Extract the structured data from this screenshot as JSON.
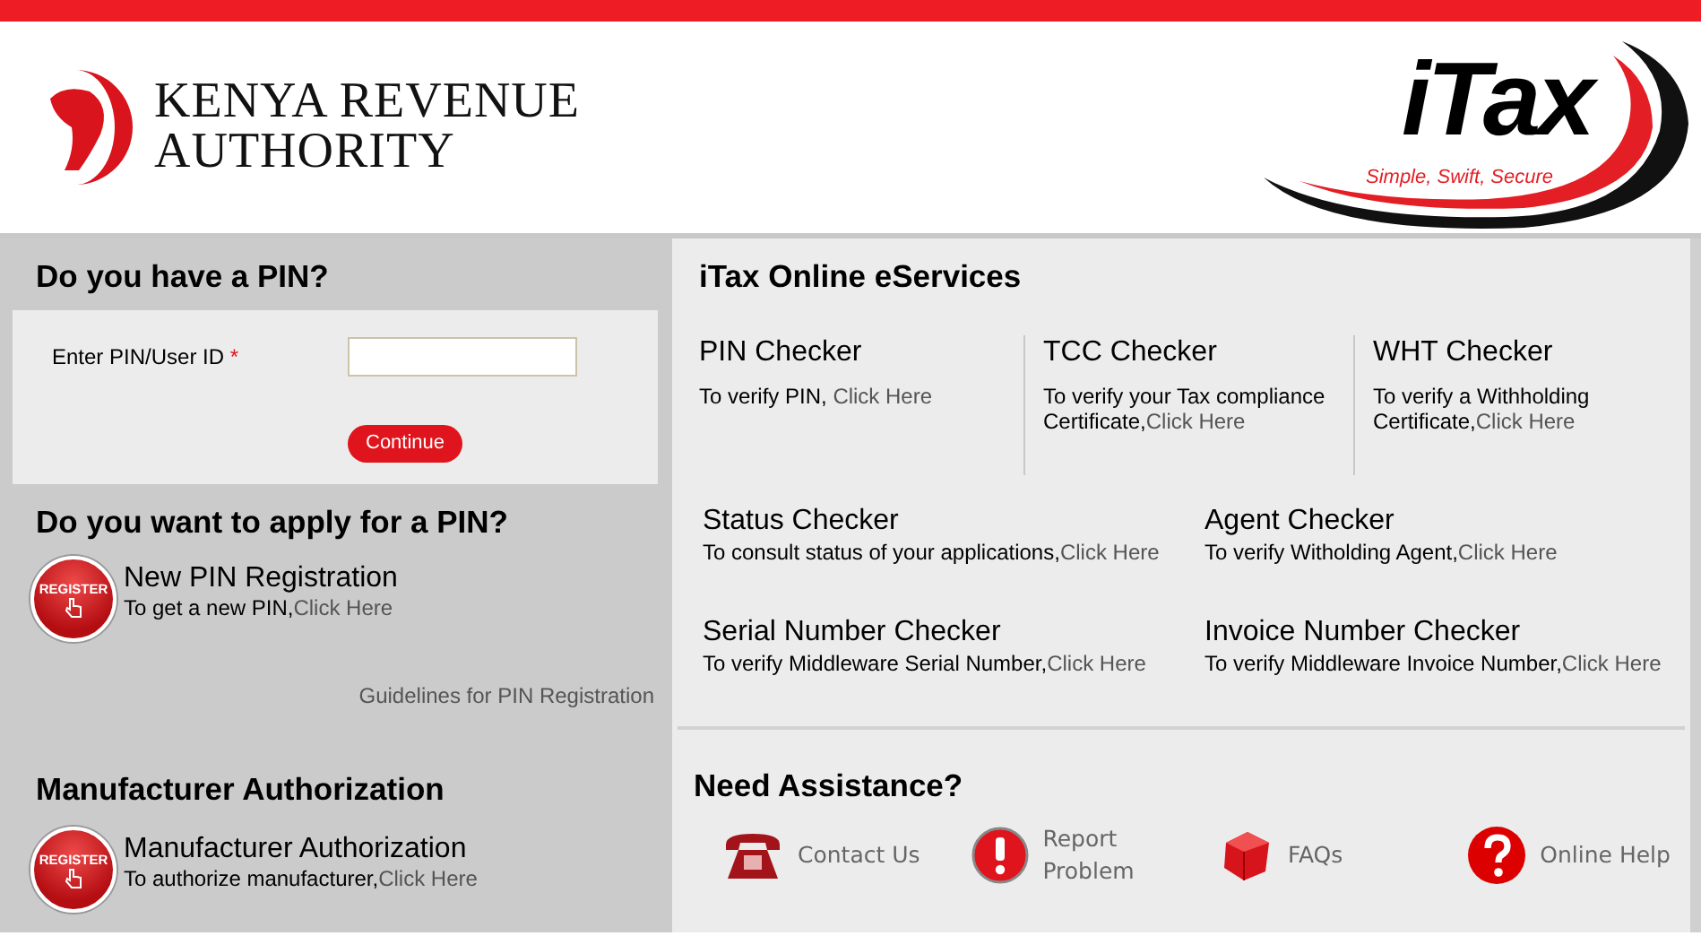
{
  "header": {
    "org_line1": "KENYA REVENUE",
    "org_line2": "AUTHORITY",
    "brand": "iTax",
    "tagline": "Simple, Swift, Secure"
  },
  "login": {
    "heading": "Do you have a PIN?",
    "label": "Enter PIN/User ID",
    "required_mark": "*",
    "button": "Continue"
  },
  "apply": {
    "heading": "Do you want to apply for a PIN?",
    "item": {
      "badge": "REGISTER",
      "title": "New PIN Registration",
      "description": "To get a new PIN,",
      "link": "Click Here"
    },
    "guidelines": "Guidelines for PIN Registration"
  },
  "manufacturer": {
    "heading": "Manufacturer Authorization",
    "item": {
      "badge": "REGISTER",
      "title": "Manufacturer Authorization",
      "description": "To authorize manufacturer,",
      "link": "Click Here"
    }
  },
  "eservices": {
    "heading": "iTax Online eServices",
    "top_row": [
      {
        "title": "PIN Checker",
        "description": "To verify PIN, ",
        "link": "Click Here"
      },
      {
        "title": "TCC Checker",
        "description": "To verify your Tax compliance Certificate,",
        "link": "Click Here"
      },
      {
        "title": "WHT Checker",
        "description": "To verify a Withholding Certificate,",
        "link": "Click Here"
      }
    ],
    "grid": [
      {
        "title": "Status Checker",
        "description": "To consult status of your applications,",
        "link": "Click Here"
      },
      {
        "title": "Agent Checker",
        "description": "To verify Witholding Agent,",
        "link": "Click Here"
      },
      {
        "title": "Serial Number Checker",
        "description": "To verify Middleware Serial Number,",
        "link": "Click Here"
      },
      {
        "title": "Invoice Number Checker",
        "description": "To verify Middleware Invoice Number,",
        "link": "Click Here"
      }
    ]
  },
  "assistance": {
    "heading": "Need Assistance?",
    "items": [
      {
        "kind": "phone",
        "label": "Contact Us"
      },
      {
        "kind": "alert",
        "label": "Report Problem"
      },
      {
        "kind": "faq",
        "label": "FAQs"
      },
      {
        "kind": "help",
        "label": "Online Help"
      }
    ]
  }
}
